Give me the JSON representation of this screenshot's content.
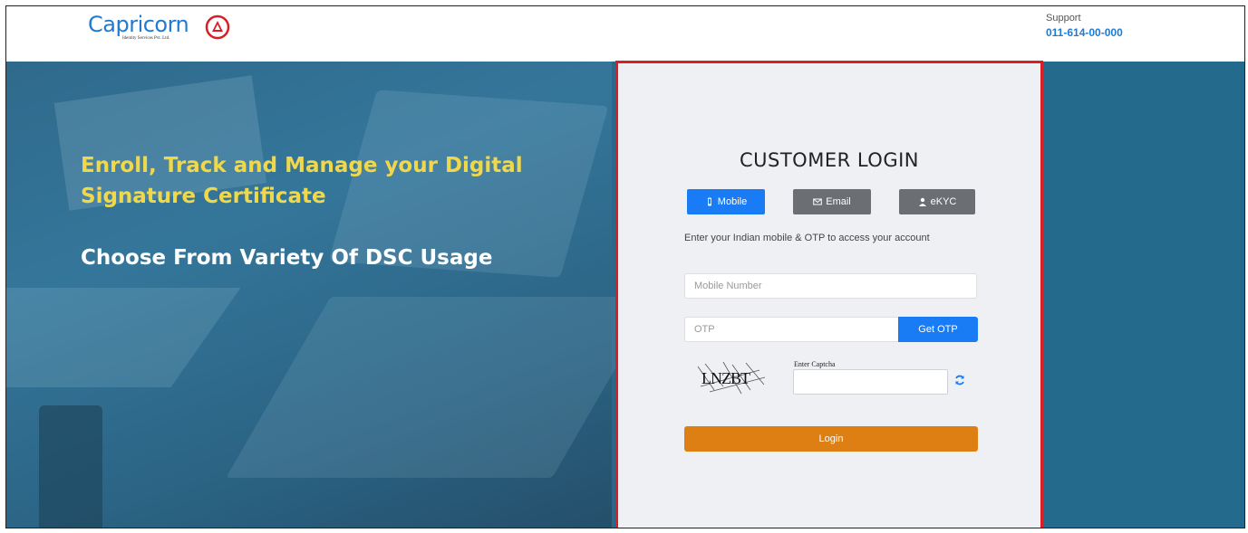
{
  "brand": {
    "name": "Capricorn",
    "tagline": "Identity Services Pvt. Ltd.",
    "color": "#1f7ad1"
  },
  "support": {
    "label": "Support",
    "phone": "011-614-00-000"
  },
  "hero": {
    "headline": "Enroll, Track and Manage your Digital Signature Certificate",
    "subline": "Choose From Variety Of DSC Usage",
    "headline_color": "#f0d84a"
  },
  "login": {
    "title": "CUSTOMER LOGIN",
    "tabs": [
      {
        "label": "Mobile",
        "icon": "mobile-icon",
        "active": true
      },
      {
        "label": "Email",
        "icon": "envelope-icon",
        "active": false
      },
      {
        "label": "eKYC",
        "icon": "user-icon",
        "active": false
      }
    ],
    "hint": "Enter your Indian mobile & OTP to access your account",
    "mobile_placeholder": "Mobile Number",
    "otp_placeholder": "OTP",
    "get_otp_label": "Get OTP",
    "captcha_text": "LNZBT",
    "captcha_label": "Enter Captcha",
    "login_label": "Login",
    "accent_blue": "#1a7cf5",
    "login_color": "#de7f14",
    "panel_border_color": "#d91f26"
  }
}
